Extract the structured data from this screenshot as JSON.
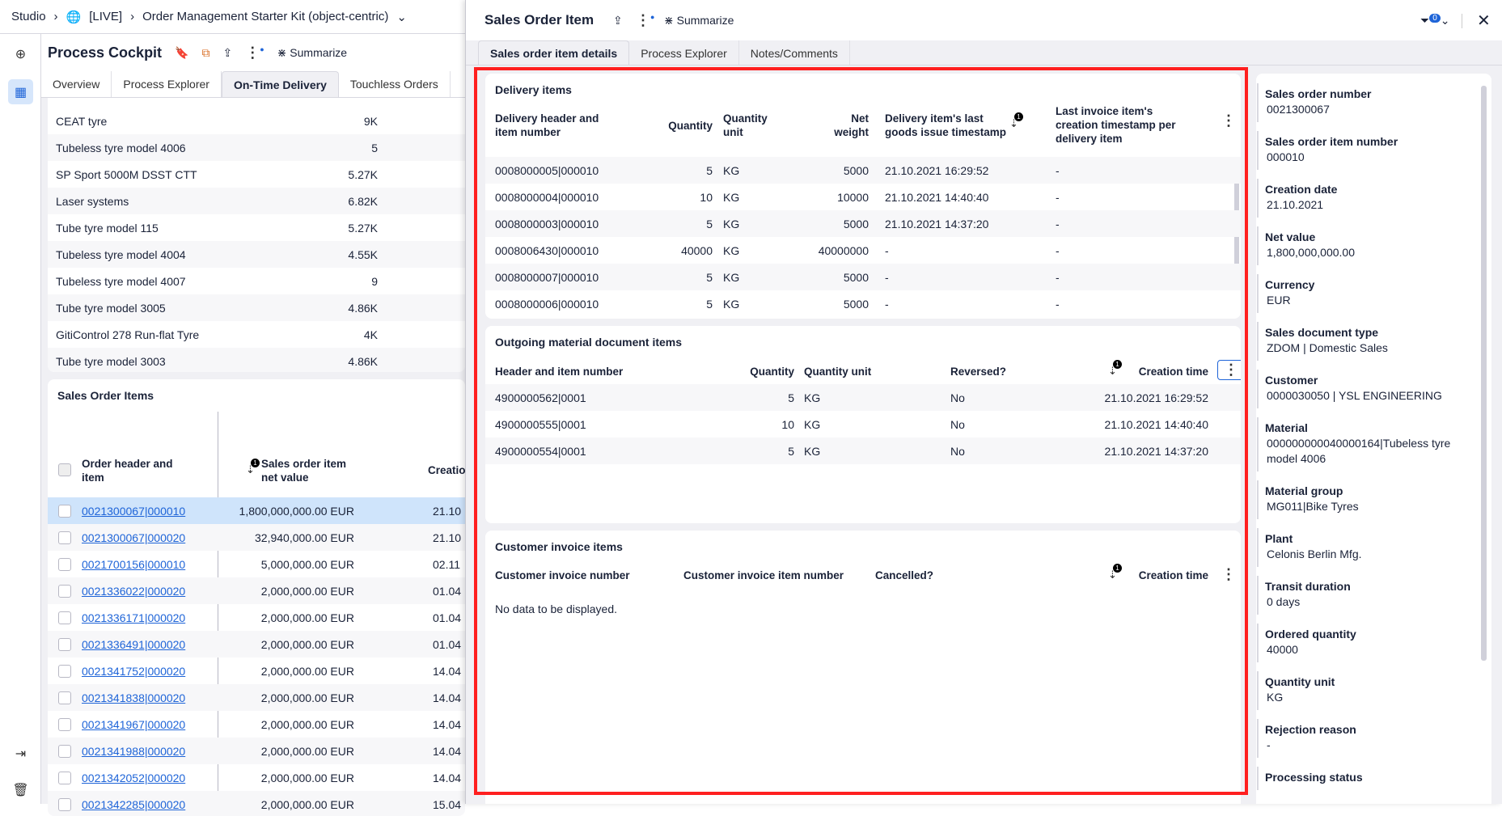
{
  "breadcrumb": {
    "items": [
      "Studio",
      "[LIVE]",
      "Order Management Starter Kit (object-centric)"
    ]
  },
  "cockpit": {
    "title": "Process Cockpit",
    "summarize": "Summarize",
    "tabs": [
      "Overview",
      "Process Explorer",
      "On-Time Delivery",
      "Touchless Orders"
    ],
    "active_tab": 2
  },
  "top_list": [
    {
      "name": "CEAT tyre",
      "value": "9K"
    },
    {
      "name": "Tubeless tyre model 4006",
      "value": "5"
    },
    {
      "name": "SP Sport 5000M DSST CTT",
      "value": "5.27K"
    },
    {
      "name": "Laser systems",
      "value": "6.82K"
    },
    {
      "name": "Tube tyre model 115",
      "value": "5.27K"
    },
    {
      "name": "Tubeless tyre model 4004",
      "value": "4.55K"
    },
    {
      "name": "Tubeless tyre model 4007",
      "value": "9"
    },
    {
      "name": "Tube tyre model 3005",
      "value": "4.86K"
    },
    {
      "name": "GitiControl 278 Run-flat Tyre",
      "value": "4K"
    },
    {
      "name": "Tube tyre model 3003",
      "value": "4.86K"
    }
  ],
  "sales_order_items": {
    "title": "Sales Order Items",
    "columns": [
      "Order header and item",
      "Sales order item net value",
      "Creation"
    ],
    "sort_badge": "1",
    "rows": [
      {
        "id": "0021300067|000010",
        "value": "1,800,000,000.00 EUR",
        "date": "21.10",
        "selected": true
      },
      {
        "id": "0021300067|000020",
        "value": "32,940,000.00 EUR",
        "date": "21.10"
      },
      {
        "id": "0021700156|000010",
        "value": "5,000,000.00 EUR",
        "date": "02.11"
      },
      {
        "id": "0021336022|000020",
        "value": "2,000,000.00 EUR",
        "date": "01.04"
      },
      {
        "id": "0021336171|000020",
        "value": "2,000,000.00 EUR",
        "date": "01.04"
      },
      {
        "id": "0021336491|000020",
        "value": "2,000,000.00 EUR",
        "date": "01.04"
      },
      {
        "id": "0021341752|000020",
        "value": "2,000,000.00 EUR",
        "date": "14.04"
      },
      {
        "id": "0021341838|000020",
        "value": "2,000,000.00 EUR",
        "date": "14.04"
      },
      {
        "id": "0021341967|000020",
        "value": "2,000,000.00 EUR",
        "date": "14.04"
      },
      {
        "id": "0021341988|000020",
        "value": "2,000,000.00 EUR",
        "date": "14.04"
      },
      {
        "id": "0021342052|000020",
        "value": "2,000,000.00 EUR",
        "date": "14.04"
      },
      {
        "id": "0021342285|000020",
        "value": "2,000,000.00 EUR",
        "date": "15.04"
      }
    ]
  },
  "drawer": {
    "title": "Sales Order Item",
    "summarize": "Summarize",
    "filter_count": "0",
    "tabs": [
      "Sales order item details",
      "Process Explorer",
      "Notes/Comments"
    ],
    "active_tab": 0
  },
  "delivery": {
    "title": "Delivery items",
    "columns": [
      "Delivery header and item number",
      "Quantity",
      "Quantity unit",
      "Net weight",
      "Delivery item's last goods issue timestamp",
      "Last invoice item's creation timestamp per delivery item"
    ],
    "sort_badge": "1",
    "rows": [
      [
        "0008000005|000010",
        "5",
        "KG",
        "5000",
        "21.10.2021 16:29:52",
        "-"
      ],
      [
        "0008000004|000010",
        "10",
        "KG",
        "10000",
        "21.10.2021 14:40:40",
        "-"
      ],
      [
        "0008000003|000010",
        "5",
        "KG",
        "5000",
        "21.10.2021 14:37:20",
        "-"
      ],
      [
        "0008006430|000010",
        "40000",
        "KG",
        "40000000",
        "-",
        "-"
      ],
      [
        "0008000007|000010",
        "5",
        "KG",
        "5000",
        "-",
        "-"
      ],
      [
        "0008000006|000010",
        "5",
        "KG",
        "5000",
        "-",
        "-"
      ]
    ]
  },
  "outgoing": {
    "title": "Outgoing material document items",
    "columns": [
      "Header and item number",
      "Quantity",
      "Quantity unit",
      "Reversed?",
      "Creation time"
    ],
    "sort_badge": "1",
    "rows": [
      [
        "4900000562|0001",
        "5",
        "KG",
        "No",
        "21.10.2021 16:29:52"
      ],
      [
        "4900000555|0001",
        "10",
        "KG",
        "No",
        "21.10.2021 14:40:40"
      ],
      [
        "4900000554|0001",
        "5",
        "KG",
        "No",
        "21.10.2021 14:37:20"
      ]
    ]
  },
  "invoice": {
    "title": "Customer invoice items",
    "columns": [
      "Customer invoice number",
      "Customer invoice item number",
      "Cancelled?",
      "Creation time"
    ],
    "sort_badge": "1",
    "empty": "No data to be displayed."
  },
  "details": [
    {
      "label": "Sales order number",
      "value": "0021300067"
    },
    {
      "label": "Sales order item number",
      "value": "000010"
    },
    {
      "label": "Creation date",
      "value": "21.10.2021"
    },
    {
      "label": "Net value",
      "value": "1,800,000,000.00"
    },
    {
      "label": "Currency",
      "value": "EUR"
    },
    {
      "label": "Sales document type",
      "value": "ZDOM | Domestic Sales"
    },
    {
      "label": "Customer",
      "value": "0000030050 | YSL ENGINEERING"
    },
    {
      "label": "Material",
      "value": "000000000040000164|Tubeless tyre model 4006"
    },
    {
      "label": "Material group",
      "value": "MG011|Bike Tyres"
    },
    {
      "label": "Plant",
      "value": "Celonis Berlin Mfg."
    },
    {
      "label": "Transit duration",
      "value": "0 days"
    },
    {
      "label": "Ordered quantity",
      "value": "40000"
    },
    {
      "label": "Quantity unit",
      "value": "KG"
    },
    {
      "label": "Rejection reason",
      "value": "-"
    },
    {
      "label": "Processing status",
      "value": ""
    }
  ],
  "colors": {
    "accent": "#1e64d8",
    "selected_row": "#cfe4fb",
    "highlight_box": "#ff1f1f",
    "panel_bg": "#f0f0f4"
  }
}
